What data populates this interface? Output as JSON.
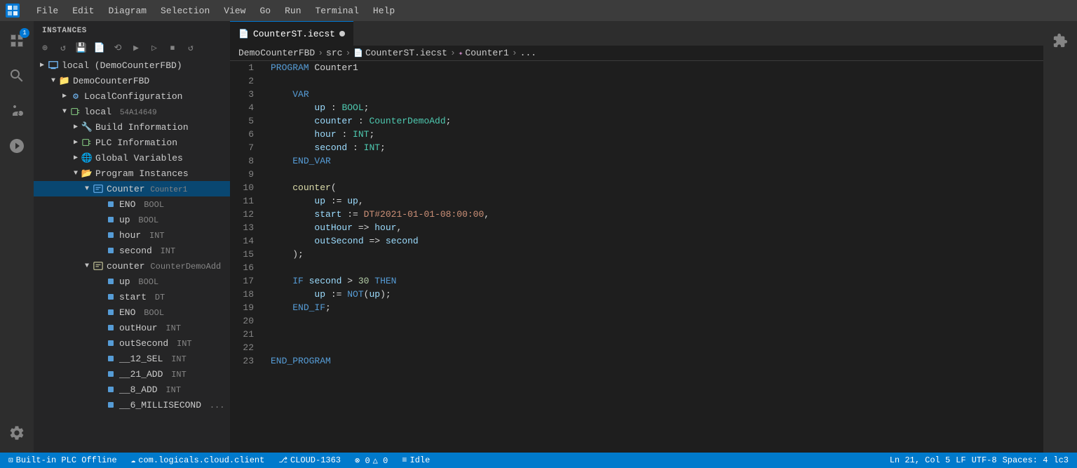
{
  "titlebar": {
    "menu_items": [
      "File",
      "Edit",
      "Diagram",
      "Selection",
      "View",
      "Go",
      "Run",
      "Terminal",
      "Help"
    ]
  },
  "sidebar": {
    "header": "INSTANCES",
    "tree": [
      {
        "id": "local",
        "label": "local (DemoCounterFBD)",
        "indent": 0,
        "type": "local",
        "arrow": "collapsed",
        "icon": "local"
      },
      {
        "id": "democounterfbd",
        "label": "DemoCounterFBD",
        "indent": 1,
        "type": "folder",
        "arrow": "expanded"
      },
      {
        "id": "localconfig",
        "label": "LocalConfiguration",
        "indent": 2,
        "type": "gear",
        "arrow": "collapsed"
      },
      {
        "id": "local2",
        "label": "local  54A14649",
        "indent": 2,
        "type": "plc",
        "arrow": "expanded"
      },
      {
        "id": "buildinfo",
        "label": "Build Information",
        "indent": 3,
        "type": "wrench",
        "arrow": "collapsed"
      },
      {
        "id": "plcinfo",
        "label": "PLC Information",
        "indent": 3,
        "type": "plc2",
        "arrow": "collapsed"
      },
      {
        "id": "globalvars",
        "label": "Global Variables",
        "indent": 3,
        "type": "globe",
        "arrow": "collapsed"
      },
      {
        "id": "programinst",
        "label": "Program Instances",
        "indent": 3,
        "type": "folder2",
        "arrow": "expanded"
      },
      {
        "id": "counter",
        "label": "Counter  Counter1",
        "indent": 4,
        "type": "program",
        "arrow": "expanded",
        "selected": true
      },
      {
        "id": "eno",
        "label": "ENO",
        "type_hint": "BOOL",
        "indent": 5,
        "type": "var_bool"
      },
      {
        "id": "up",
        "label": "up",
        "type_hint": "BOOL",
        "indent": 5,
        "type": "var_bool"
      },
      {
        "id": "hour",
        "label": "hour",
        "type_hint": "INT",
        "indent": 5,
        "type": "var_int"
      },
      {
        "id": "second",
        "label": "second",
        "type_hint": "INT",
        "indent": 5,
        "type": "var_int"
      },
      {
        "id": "counter2",
        "label": "counter  CounterDemoAdd",
        "indent": 4,
        "type": "program2",
        "arrow": "expanded"
      },
      {
        "id": "up2",
        "label": "up",
        "type_hint": "BOOL",
        "indent": 5,
        "type": "var_bool"
      },
      {
        "id": "start",
        "label": "start",
        "type_hint": "DT",
        "indent": 5,
        "type": "var_int"
      },
      {
        "id": "eno2",
        "label": "ENO",
        "type_hint": "BOOL",
        "indent": 5,
        "type": "var_bool"
      },
      {
        "id": "outhour",
        "label": "outHour",
        "type_hint": "INT",
        "indent": 5,
        "type": "var_int"
      },
      {
        "id": "outsecond",
        "label": "outSecond",
        "type_hint": "INT",
        "indent": 5,
        "type": "var_int"
      },
      {
        "id": "sel12",
        "label": "__12_SEL",
        "type_hint": "INT",
        "indent": 5,
        "type": "var_int"
      },
      {
        "id": "add21",
        "label": "__21_ADD",
        "type_hint": "INT",
        "indent": 5,
        "type": "var_int"
      },
      {
        "id": "add8",
        "label": "__8_ADD",
        "type_hint": "INT",
        "indent": 5,
        "type": "var_int"
      },
      {
        "id": "ms6",
        "label": "__6_MILLISECOND",
        "type_hint": "...",
        "indent": 5,
        "type": "var_int"
      }
    ]
  },
  "tab": {
    "filename": "CounterST.iecst",
    "modified": true
  },
  "breadcrumb": {
    "items": [
      "DemoCounterFBD",
      "src",
      "CounterST.iecst",
      "Counter1",
      "..."
    ]
  },
  "code": {
    "lines": [
      {
        "num": 1,
        "content": "PROGRAM Counter1",
        "tokens": [
          {
            "t": "kw",
            "v": "PROGRAM"
          },
          {
            "t": "text",
            "v": " Counter1"
          }
        ]
      },
      {
        "num": 2,
        "content": "",
        "tokens": []
      },
      {
        "num": 3,
        "content": "    VAR",
        "tokens": [
          {
            "t": "text",
            "v": "    "
          },
          {
            "t": "kw",
            "v": "VAR"
          }
        ]
      },
      {
        "num": 4,
        "content": "        up : BOOL;",
        "tokens": [
          {
            "t": "text",
            "v": "        "
          },
          {
            "t": "var",
            "v": "up"
          },
          {
            "t": "text",
            "v": " : "
          },
          {
            "t": "type",
            "v": "BOOL"
          },
          {
            "t": "text",
            "v": ";"
          }
        ]
      },
      {
        "num": 5,
        "content": "        counter : CounterDemoAdd;",
        "tokens": [
          {
            "t": "text",
            "v": "        "
          },
          {
            "t": "var",
            "v": "counter"
          },
          {
            "t": "text",
            "v": " : "
          },
          {
            "t": "type",
            "v": "CounterDemoAdd"
          },
          {
            "t": "text",
            "v": ";"
          }
        ]
      },
      {
        "num": 6,
        "content": "        hour : INT;",
        "tokens": [
          {
            "t": "text",
            "v": "        "
          },
          {
            "t": "var",
            "v": "hour"
          },
          {
            "t": "text",
            "v": " : "
          },
          {
            "t": "type",
            "v": "INT"
          },
          {
            "t": "text",
            "v": ";"
          }
        ]
      },
      {
        "num": 7,
        "content": "        second : INT;",
        "tokens": [
          {
            "t": "text",
            "v": "        "
          },
          {
            "t": "var",
            "v": "second"
          },
          {
            "t": "text",
            "v": " : "
          },
          {
            "t": "type",
            "v": "INT"
          },
          {
            "t": "text",
            "v": ";"
          }
        ]
      },
      {
        "num": 8,
        "content": "    END_VAR",
        "tokens": [
          {
            "t": "text",
            "v": "    "
          },
          {
            "t": "kw",
            "v": "END_VAR"
          }
        ]
      },
      {
        "num": 9,
        "content": "",
        "tokens": []
      },
      {
        "num": 10,
        "content": "    counter(",
        "tokens": [
          {
            "t": "text",
            "v": "    "
          },
          {
            "t": "fn",
            "v": "counter"
          },
          {
            "t": "text",
            "v": "("
          }
        ]
      },
      {
        "num": 11,
        "content": "        up := up,",
        "tokens": [
          {
            "t": "text",
            "v": "        "
          },
          {
            "t": "var",
            "v": "up"
          },
          {
            "t": "text",
            "v": " := "
          },
          {
            "t": "var",
            "v": "up"
          },
          {
            "t": "text",
            "v": ","
          }
        ]
      },
      {
        "num": 12,
        "content": "        start := DT#2021-01-01-08:00:00,",
        "tokens": [
          {
            "t": "text",
            "v": "        "
          },
          {
            "t": "var",
            "v": "start"
          },
          {
            "t": "text",
            "v": " := "
          },
          {
            "t": "str",
            "v": "DT#2021-01-01-08:00:00"
          },
          {
            "t": "text",
            "v": ","
          }
        ]
      },
      {
        "num": 13,
        "content": "        outHour => hour,",
        "tokens": [
          {
            "t": "text",
            "v": "        "
          },
          {
            "t": "var",
            "v": "outHour"
          },
          {
            "t": "text",
            "v": " => "
          },
          {
            "t": "var",
            "v": "hour"
          },
          {
            "t": "text",
            "v": ","
          }
        ]
      },
      {
        "num": 14,
        "content": "        outSecond => second",
        "tokens": [
          {
            "t": "text",
            "v": "        "
          },
          {
            "t": "var",
            "v": "outSecond"
          },
          {
            "t": "text",
            "v": " => "
          },
          {
            "t": "var",
            "v": "second"
          }
        ]
      },
      {
        "num": 15,
        "content": "    );",
        "tokens": [
          {
            "t": "text",
            "v": "    );"
          }
        ]
      },
      {
        "num": 16,
        "content": "",
        "tokens": []
      },
      {
        "num": 17,
        "content": "    IF second > 30 THEN",
        "tokens": [
          {
            "t": "text",
            "v": "    "
          },
          {
            "t": "kw",
            "v": "IF"
          },
          {
            "t": "text",
            "v": " "
          },
          {
            "t": "var",
            "v": "second"
          },
          {
            "t": "text",
            "v": " > "
          },
          {
            "t": "num",
            "v": "30"
          },
          {
            "t": "text",
            "v": " "
          },
          {
            "t": "kw",
            "v": "THEN"
          }
        ]
      },
      {
        "num": 18,
        "content": "        up := NOT(up);",
        "tokens": [
          {
            "t": "text",
            "v": "        "
          },
          {
            "t": "var",
            "v": "up"
          },
          {
            "t": "text",
            "v": " := "
          },
          {
            "t": "kw",
            "v": "NOT"
          },
          {
            "t": "text",
            "v": "("
          },
          {
            "t": "var",
            "v": "up"
          },
          {
            "t": "text",
            "v": ");"
          }
        ]
      },
      {
        "num": 19,
        "content": "    END_IF;",
        "tokens": [
          {
            "t": "text",
            "v": "    "
          },
          {
            "t": "kw",
            "v": "END_IF"
          },
          {
            "t": "text",
            "v": ";"
          }
        ]
      },
      {
        "num": 20,
        "content": "",
        "tokens": []
      },
      {
        "num": 21,
        "content": "",
        "tokens": []
      },
      {
        "num": 22,
        "content": "",
        "tokens": []
      },
      {
        "num": 23,
        "content": "END_PROGRAM",
        "tokens": [
          {
            "t": "kw",
            "v": "END_PROGRAM"
          }
        ]
      }
    ]
  },
  "statusbar": {
    "left_items": [
      {
        "label": "Built-in PLC Offline",
        "icon": "plc-icon"
      },
      {
        "label": "com.logicals.cloud.client",
        "icon": "cloud-icon"
      },
      {
        "label": "CLOUD-1363",
        "icon": "branch-icon"
      },
      {
        "label": "⊗ 0 △ 0",
        "icon": ""
      },
      {
        "label": "Idle",
        "icon": "idle-icon"
      }
    ],
    "right_items": [
      {
        "label": "Ln 21, Col 5"
      },
      {
        "label": "LF"
      },
      {
        "label": "UTF-8"
      },
      {
        "label": "Spaces: 4"
      },
      {
        "label": "lc3"
      }
    ]
  }
}
